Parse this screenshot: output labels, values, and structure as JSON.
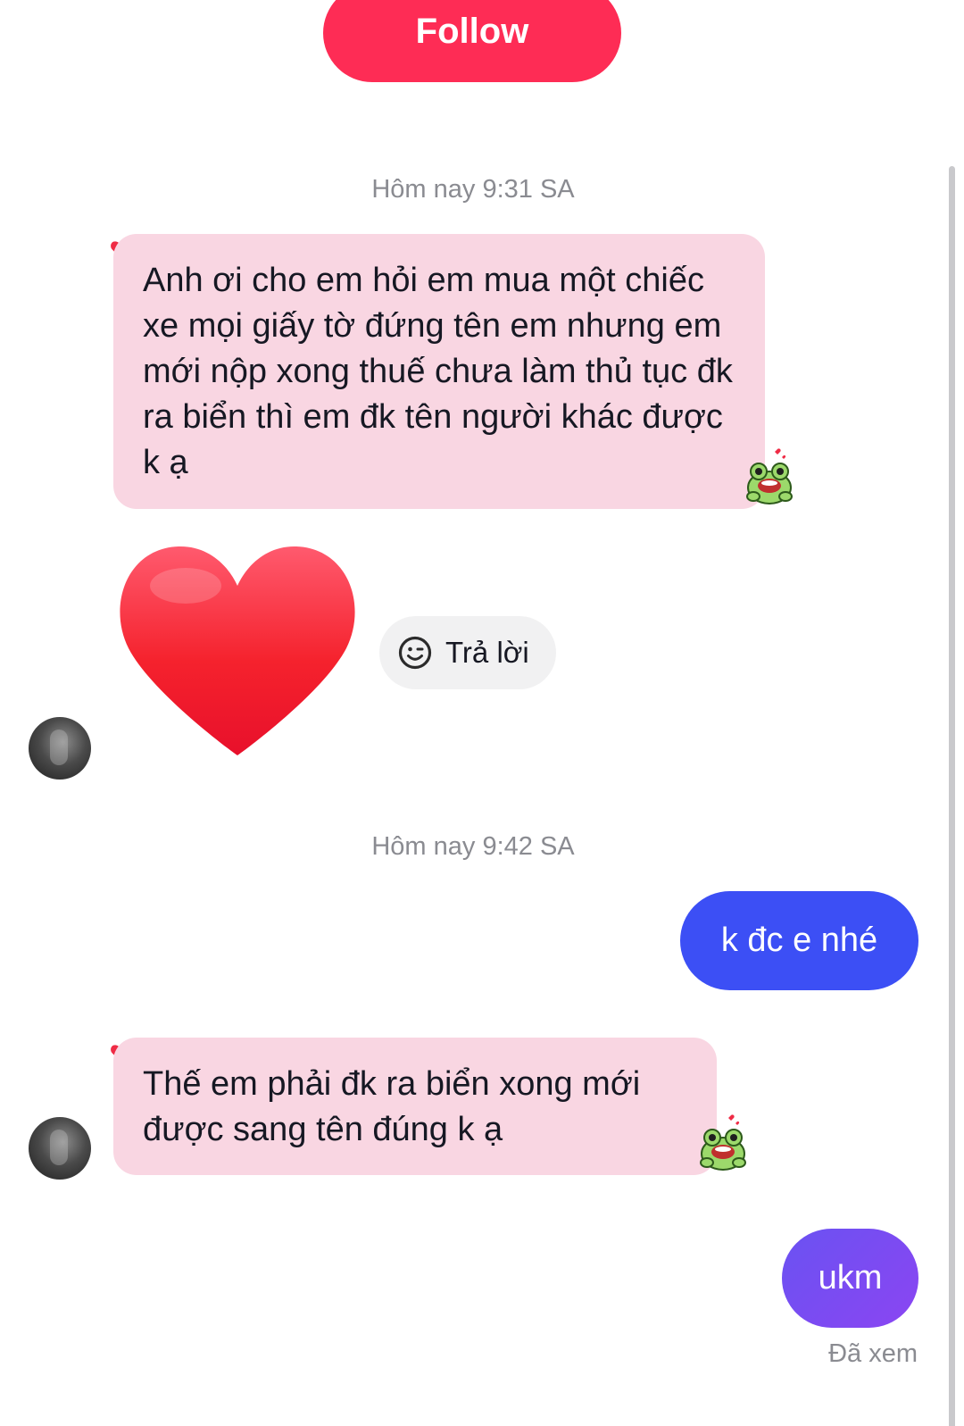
{
  "header": {
    "follow_label": "Follow"
  },
  "messages": {
    "timestamp_1": "Hôm nay 9:31 SA",
    "msg_1": "Anh ơi cho em hỏi em mua một chiếc xe mọi giấy tờ đứng tên em nhưng em mới nộp xong thuế chưa làm thủ tục đk ra biển thì em đk tên người khác được k ạ",
    "reply_label": "Trả lời",
    "timestamp_2": "Hôm nay 9:42 SA",
    "msg_2": "k đc e nhé",
    "msg_3": "Thế em phải đk ra biển xong mới được sang tên đúng k ạ",
    "msg_4": "ukm",
    "seen_label": "Đã xem"
  },
  "icons": {
    "reply": "smiley-icon",
    "reaction": "frog-sticker-icon",
    "liked": "heart-icon"
  },
  "colors": {
    "follow": "#fe2c55",
    "incoming_bubble": "#f9d6e2",
    "outgoing_bubble": "#3c4ff5",
    "outgoing_bubble_2": "#7b4cf2"
  }
}
